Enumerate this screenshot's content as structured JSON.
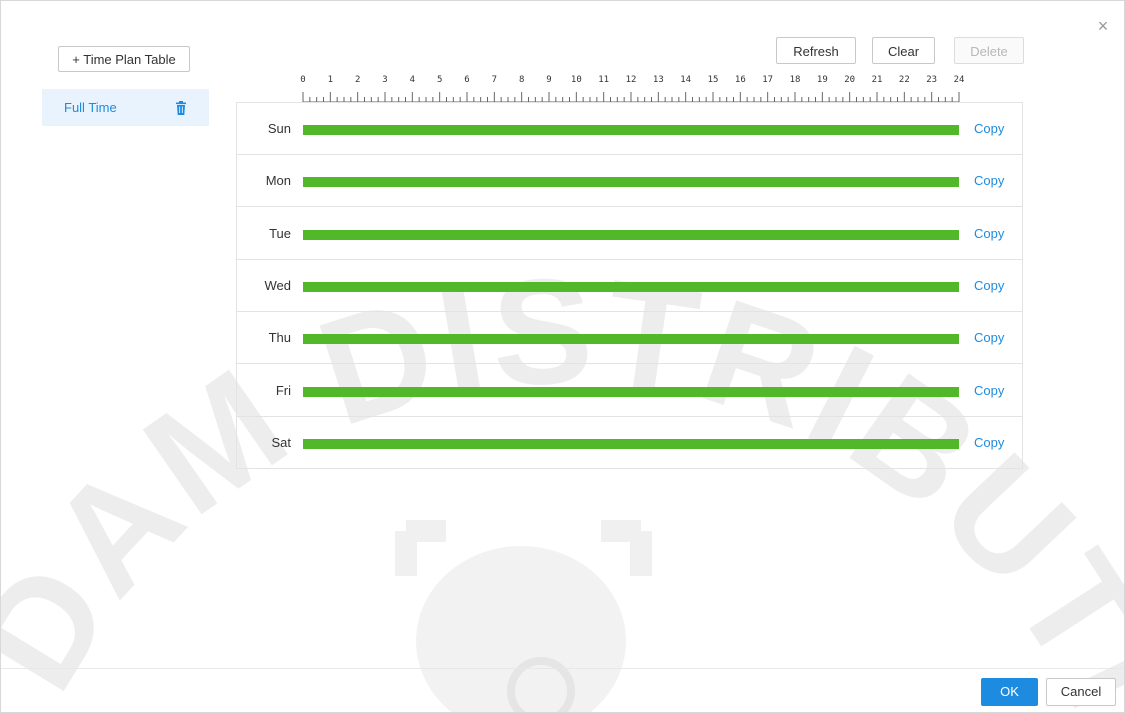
{
  "dialog": {
    "close_icon": "close-icon",
    "close_glyph": "×"
  },
  "sidebar": {
    "add_plan_label": "+ Time Plan Table",
    "plans": [
      {
        "label": "Full Time",
        "icon": "trash-icon",
        "selected": true
      }
    ]
  },
  "toolbar": {
    "refresh_label": "Refresh",
    "clear_label": "Clear",
    "delete_label": "Delete"
  },
  "ruler": {
    "hours": [
      "0",
      "1",
      "2",
      "3",
      "4",
      "5",
      "6",
      "7",
      "8",
      "9",
      "10",
      "11",
      "12",
      "13",
      "14",
      "15",
      "16",
      "17",
      "18",
      "19",
      "20",
      "21",
      "22",
      "23",
      "24"
    ]
  },
  "schedule": {
    "copy_label": "Copy",
    "bar_color": "#52b82a",
    "days": [
      {
        "label": "Sun",
        "segments": [
          [
            0,
            24
          ]
        ]
      },
      {
        "label": "Mon",
        "segments": [
          [
            0,
            24
          ]
        ]
      },
      {
        "label": "Tue",
        "segments": [
          [
            0,
            24
          ]
        ]
      },
      {
        "label": "Wed",
        "segments": [
          [
            0,
            24
          ]
        ]
      },
      {
        "label": "Thu",
        "segments": [
          [
            0,
            24
          ]
        ]
      },
      {
        "label": "Fri",
        "segments": [
          [
            0,
            24
          ]
        ]
      },
      {
        "label": "Sat",
        "segments": [
          [
            0,
            24
          ]
        ]
      }
    ]
  },
  "footer": {
    "ok_label": "OK",
    "cancel_label": "Cancel",
    "accent_color": "#1d8ce0"
  },
  "watermark": {
    "text": "DAM DISTRIBUTION"
  }
}
